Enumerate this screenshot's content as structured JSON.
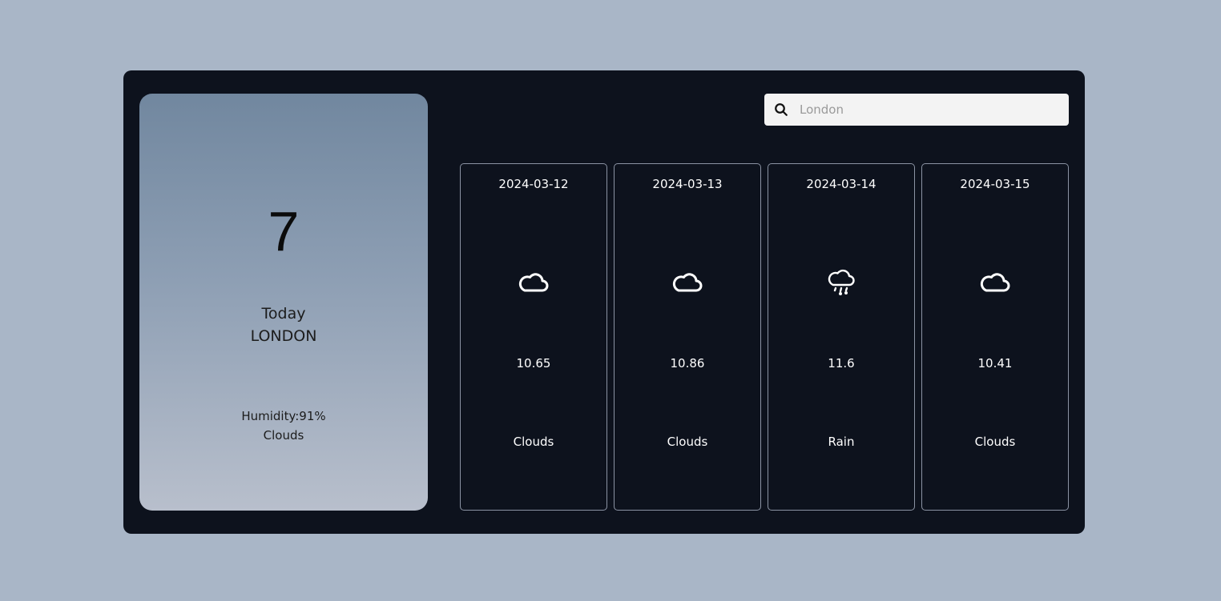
{
  "today": {
    "temperature": "7",
    "label": "Today",
    "city": "LONDON",
    "humidity": "Humidity:91%",
    "description": "Clouds"
  },
  "search": {
    "icon": "search-icon",
    "placeholder": "London",
    "value": ""
  },
  "forecast": [
    {
      "date": "2024-03-12",
      "icon": "cloud-icon",
      "temp": "10.65",
      "description": "Clouds"
    },
    {
      "date": "2024-03-13",
      "icon": "cloud-icon",
      "temp": "10.86",
      "description": "Clouds"
    },
    {
      "date": "2024-03-14",
      "icon": "cloud-rain-icon",
      "temp": "11.6",
      "description": "Rain"
    },
    {
      "date": "2024-03-15",
      "icon": "cloud-icon",
      "temp": "10.41",
      "description": "Clouds"
    }
  ],
  "colors": {
    "page_background": "#a9b6c7",
    "app_background": "#0d121d",
    "card_border": "#8b93a3",
    "text_light": "#ffffff"
  }
}
